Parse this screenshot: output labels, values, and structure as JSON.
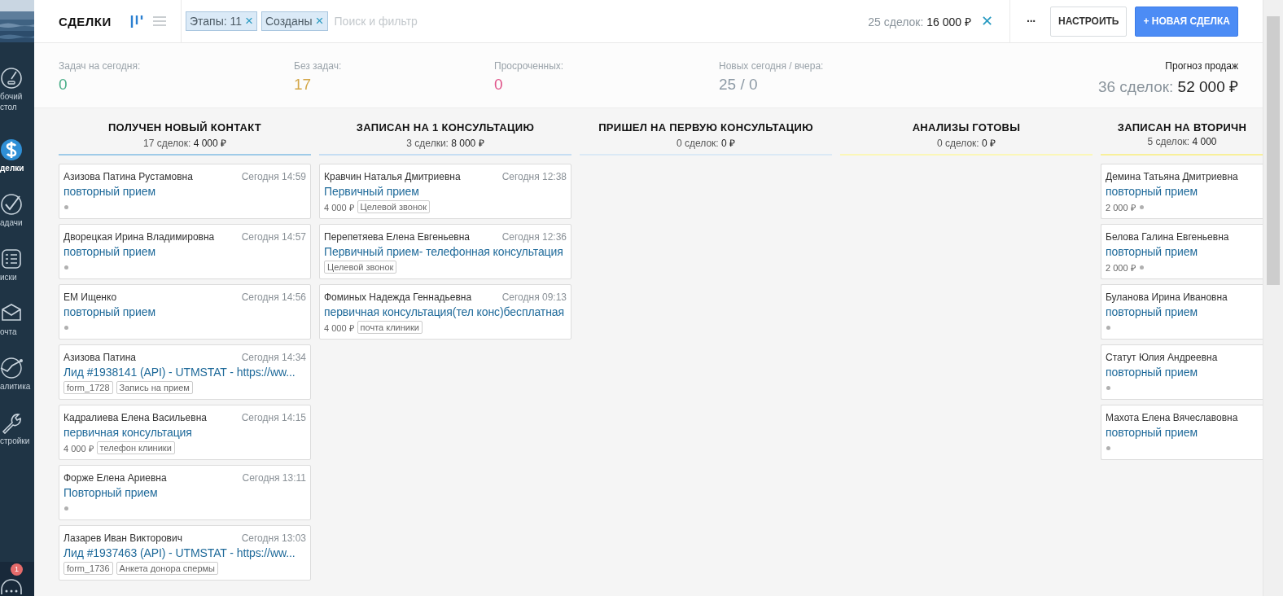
{
  "sidebar": {
    "items": [
      {
        "label": "бочий стол",
        "selected": false
      },
      {
        "label": "делки",
        "selected": true
      },
      {
        "label": "адачи",
        "selected": false
      },
      {
        "label": "иски",
        "selected": false
      },
      {
        "label": "очта",
        "selected": false
      },
      {
        "label": "алитика",
        "selected": false
      },
      {
        "label": "стройки",
        "selected": false
      }
    ],
    "chat_badge": "1"
  },
  "header": {
    "title": "СДЕЛКИ",
    "views": [
      {
        "kind": "pipeline",
        "selected": true
      },
      {
        "kind": "list",
        "selected": false
      }
    ],
    "filters": [
      {
        "label": "Этапы: 11",
        "remove": "×"
      },
      {
        "label": "Созданы",
        "remove": "×"
      }
    ],
    "search": {
      "placeholder": "Поиск и фильтр"
    },
    "summary": {
      "count": "25 сделок:",
      "amount": "16 000 ₽",
      "clear": "✕"
    },
    "more": "···",
    "buttons": [
      {
        "kind": "secondary",
        "label": "НАСТРОИТЬ"
      },
      {
        "kind": "primary",
        "label": "+ НОВАЯ СДЕЛКА"
      }
    ]
  },
  "stats": [
    {
      "label": "Задач на сегодня:",
      "value": "0",
      "color": "#4caf8a"
    },
    {
      "label": "Без задач:",
      "value": "17",
      "color": "#d4a84a"
    },
    {
      "label": "Просроченных:",
      "value": "0",
      "color": "#e0558a"
    },
    {
      "label": "Новых сегодня / вчера:",
      "value": "25 / 0",
      "color": "#8e9ba6"
    }
  ],
  "forecast": {
    "label": "Прогноз продаж",
    "count": "36 сделок:",
    "amount": "52 000 ₽"
  },
  "columns": [
    {
      "title": "ПОЛУЧЕН НОВЫЙ КОНТАКТ",
      "count": "17 сделок:",
      "amount": "4 000 ₽",
      "color": "#9fcbe8",
      "cards": [
        {
          "name": "Азизова Патина Рустамовна",
          "time": "Сегодня 14:59",
          "title": "повторный прием",
          "dot": true
        },
        {
          "name": "Дворецкая Ирина Владимировна",
          "time": "Сегодня 14:57",
          "title": "повторный прием",
          "dot": true
        },
        {
          "name": "ЕМ Ищенко",
          "time": "Сегодня 14:56",
          "title": "повторный прием",
          "dot": true
        },
        {
          "name": "Азизова Патина",
          "time": "Сегодня 14:34",
          "title": "Лид #1938141 (API) - UTMSTAT - https://ww...",
          "tags": [
            "form_1728",
            "Запись на прием"
          ],
          "dot": false
        },
        {
          "name": "Кадралиева Елена Васильевна",
          "time": "Сегодня 14:15",
          "title": "первичная консультация",
          "price": "4 000 ₽",
          "tags": [
            "телефон клиники"
          ],
          "dot": false
        },
        {
          "name": "Форже Елена Ариевна",
          "time": "Сегодня 13:11",
          "title": "Повторный прием",
          "dot": true
        },
        {
          "name": "Лазарев Иван Викторович",
          "time": "Сегодня 13:03",
          "title": "Лид #1937463 (API) - UTMSTAT - https://ww...",
          "tags": [
            "form_1736",
            "Анкета донора спермы"
          ],
          "dot": false
        }
      ]
    },
    {
      "title": "ЗАПИСАН НА 1 КОНСУЛЬТАЦИЮ",
      "count": "3 сделки:",
      "amount": "8 000 ₽",
      "color": "#c6def3",
      "cards": [
        {
          "name": "Кравчин Наталья Дмитриевна",
          "time": "Сегодня 12:38",
          "title": "Первичный прием",
          "price": "4 000 ₽",
          "tags": [
            "Целевой звонок"
          ],
          "dot": false
        },
        {
          "name": "Перепетяева Елена Евгеньевна",
          "time": "Сегодня 12:36",
          "title": "Первичный прием- телефонная консультация",
          "tags": [
            "Целевой звонок"
          ],
          "dot": false
        },
        {
          "name": "Фоминых Надежда Геннадьевна",
          "time": "Сегодня 09:13",
          "title": "первичная консультация(тел конс)бесплатная",
          "price": "4 000 ₽",
          "tags": [
            "почта клиники"
          ],
          "dot": false
        }
      ]
    },
    {
      "title": "ПРИШЕЛ НА ПЕРВУЮ КОНСУЛЬТАЦИЮ",
      "count": "0 сделок:",
      "amount": "0 ₽",
      "color": "#dbe9f5"
    },
    {
      "title": "АНАЛИЗЫ ГОТОВЫ",
      "count": "0 сделок:",
      "amount": "0 ₽",
      "color": "#fbf7b8"
    },
    {
      "title": "ЗАПИСАН НА ВТОРИЧН",
      "count": "5 сделок:",
      "amount": "4 000",
      "color": "#f8f09a",
      "cards": [
        {
          "name": "Демина Татьяна Дмитриевна",
          "title": "повторный прием",
          "price": "2 000 ₽",
          "dot": true
        },
        {
          "name": "Белова Галина Евгеньевна",
          "title": "повторный прием",
          "price": "2 000 ₽",
          "dot": true
        },
        {
          "name": "Буланова Ирина Ивановна",
          "title": "повторный прием",
          "dot": true
        },
        {
          "name": "Статут Юлия Андреевна",
          "title": "повторный прием",
          "dot": true
        },
        {
          "name": "Махота Елена Вячеславовна",
          "title": "повторный прием",
          "dot": true
        }
      ]
    }
  ]
}
